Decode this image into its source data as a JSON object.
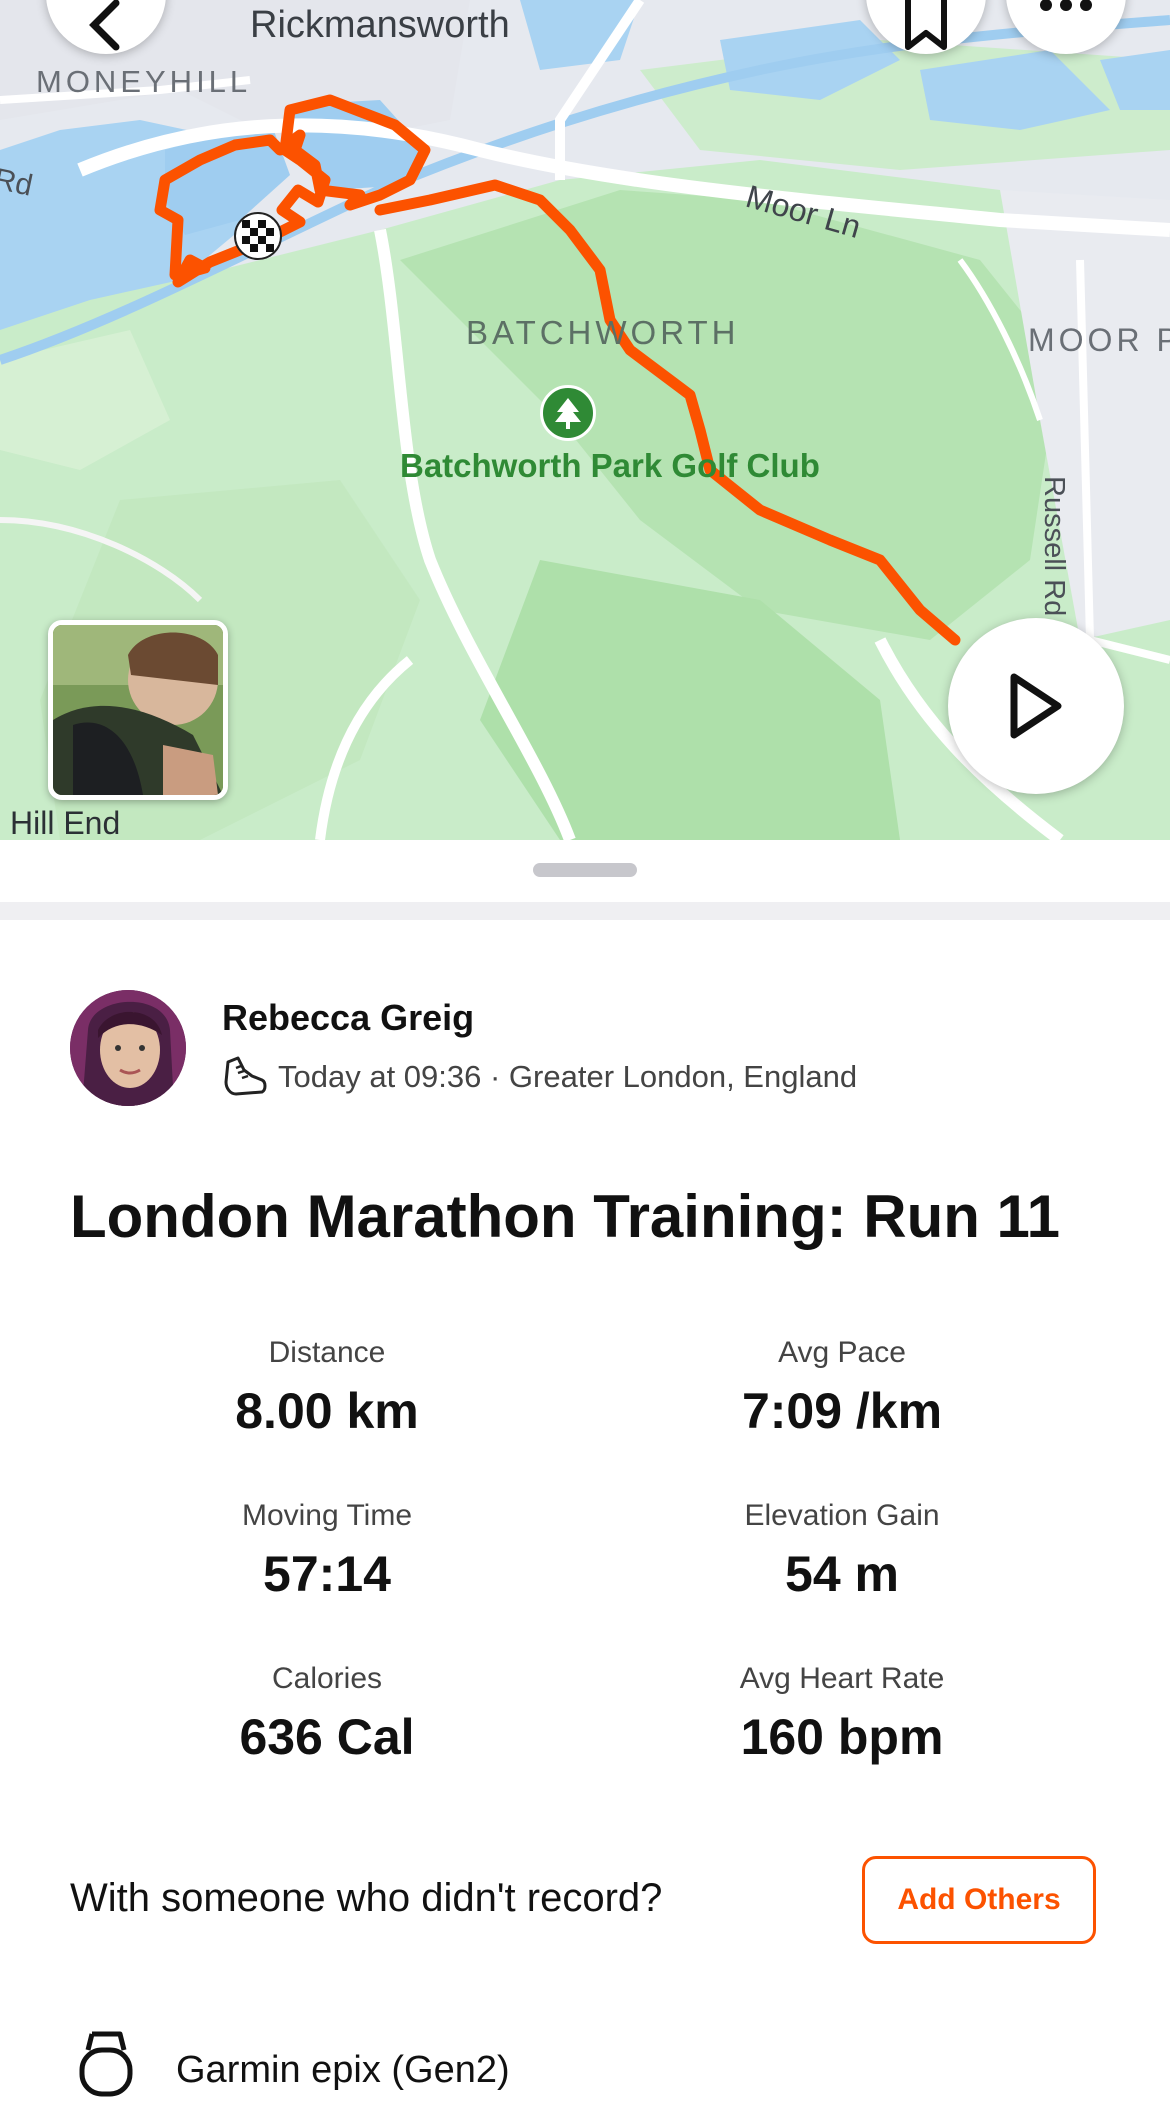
{
  "map": {
    "labels": {
      "rickmansworth": "Rickmansworth",
      "moneyhill": "MONEYHILL",
      "rd": "Rd",
      "moor_ln": "Moor Ln",
      "batchworth": "BATCHWORTH",
      "moor_park": "MOOR P",
      "russell_rd": "Russell Rd",
      "golf_club": "Batchworth Park Golf Club",
      "hill_end": "Hill End"
    },
    "route_color": "#fc5200",
    "icons": {
      "back": "back-chevron-icon",
      "bookmark": "bookmark-icon",
      "more": "more-icon",
      "play": "play-icon",
      "finish": "finish-flag-icon",
      "golf": "tree-icon"
    }
  },
  "athlete": {
    "name": "Rebecca Greig",
    "meta": "Today at 09:36 · Greater London, England",
    "activity_icon": "running-shoe-icon"
  },
  "activity": {
    "title": "London Marathon Training: Run 11"
  },
  "stats": [
    {
      "label": "Distance",
      "value": "8.00 km"
    },
    {
      "label": "Avg Pace",
      "value": "7:09 /km"
    },
    {
      "label": "Moving Time",
      "value": "57:14"
    },
    {
      "label": "Elevation Gain",
      "value": "54 m"
    },
    {
      "label": "Calories",
      "value": "636 Cal"
    },
    {
      "label": "Avg Heart Rate",
      "value": "160 bpm"
    }
  ],
  "others": {
    "prompt": "With someone who didn't record?",
    "button_label": "Add Others"
  },
  "device": {
    "name": "Garmin epix (Gen2)",
    "icon": "watch-icon"
  },
  "colors": {
    "accent": "#fc5200",
    "park_green": "#2f8a35",
    "water": "#a9d3f2"
  }
}
